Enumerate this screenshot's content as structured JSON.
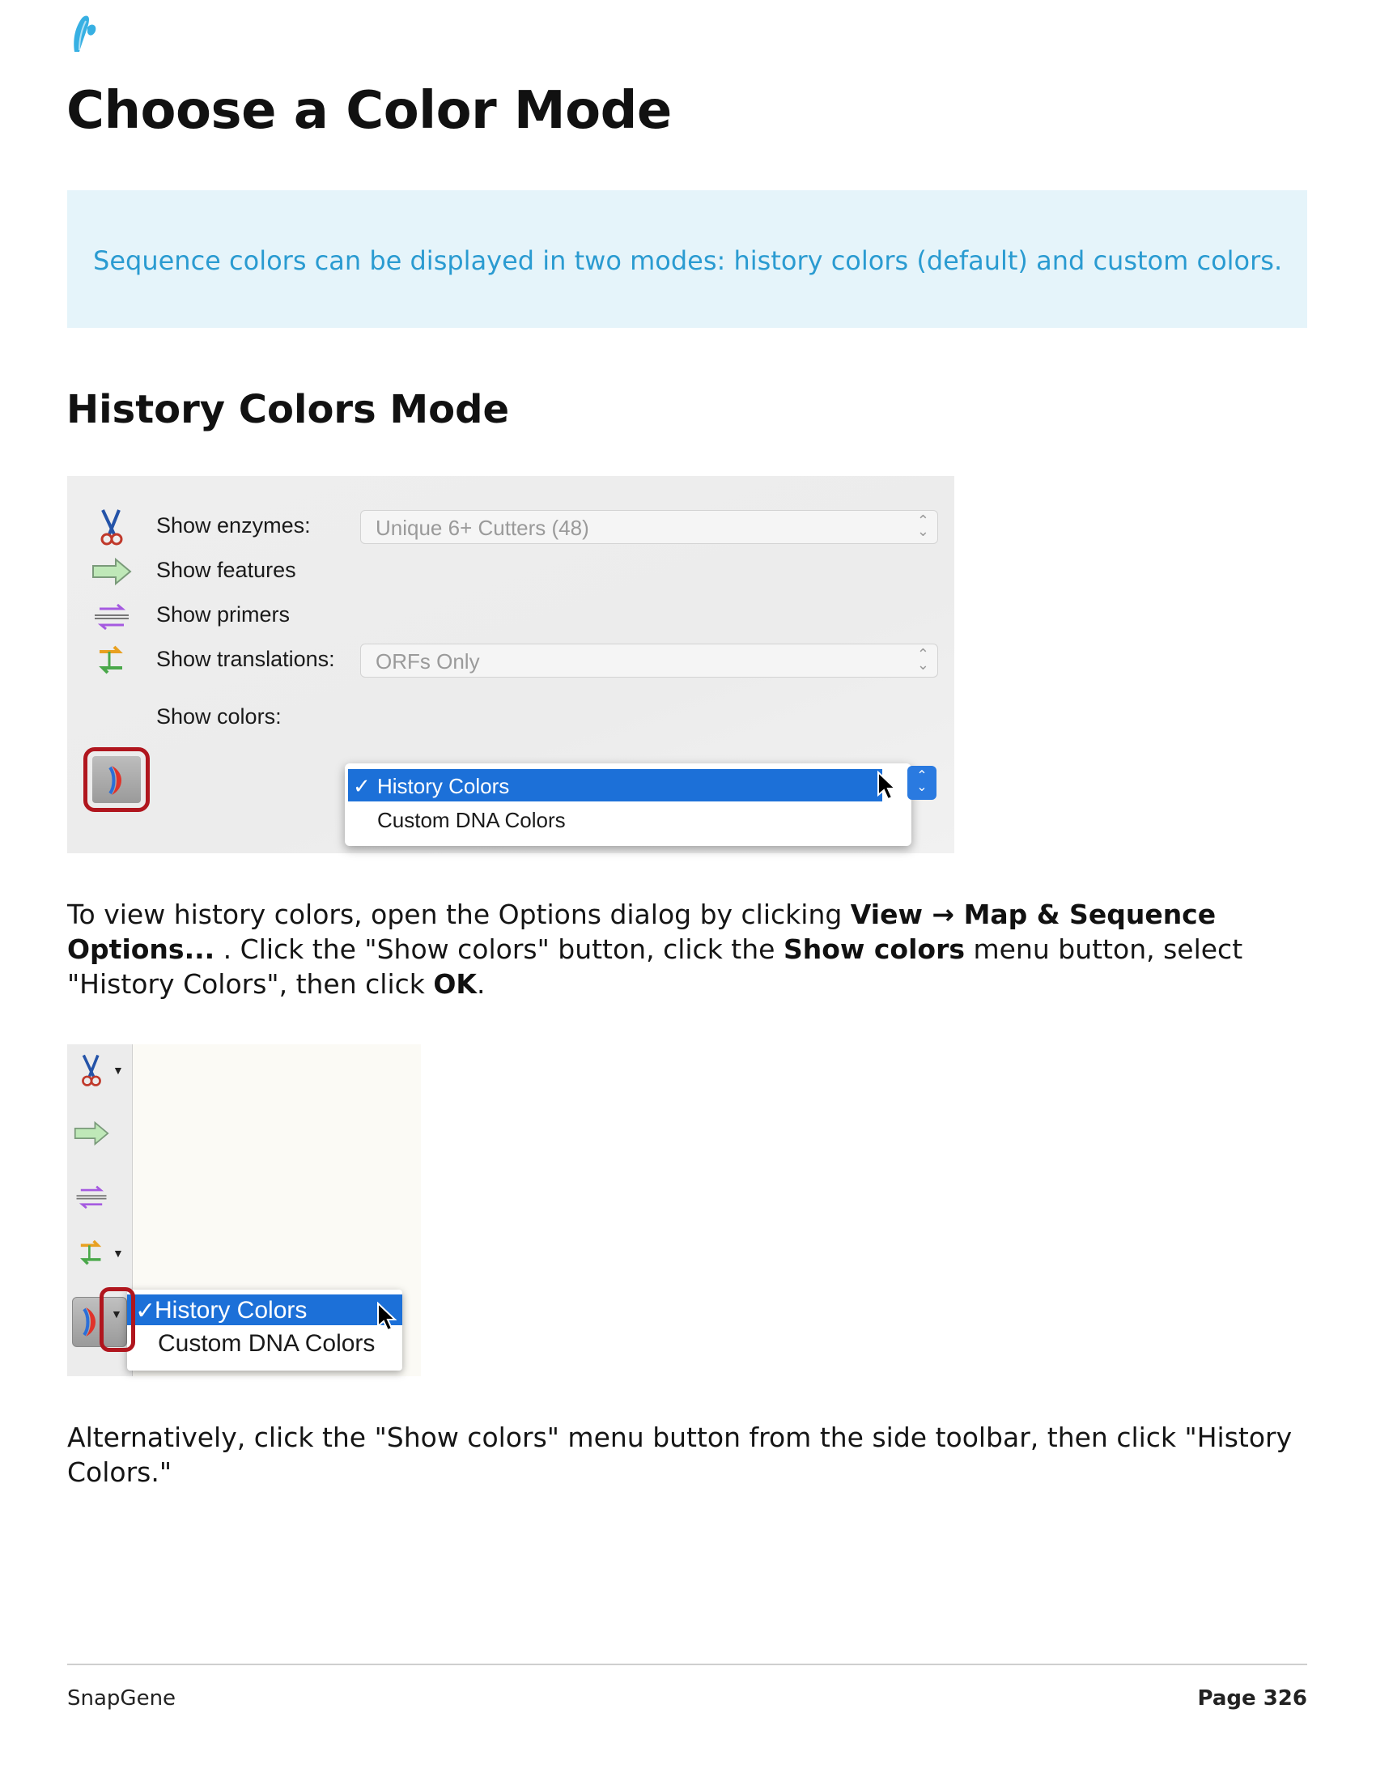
{
  "brand": {
    "accent": "#2a9bd1",
    "callout_bg": "#e5f4fa",
    "highlight": "#b0161e",
    "menu_selected": "#1c70d8"
  },
  "page_title": "Choose a Color Mode",
  "callout": {
    "text": "Sequence colors can be displayed in two modes: history colors (default) and custom colors."
  },
  "section_title": "History Colors Mode",
  "options_dialog": {
    "rows": [
      {
        "label": "Show enzymes:",
        "icon": "scissors-icon",
        "popup_value": "Unique 6+ Cutters  (48)"
      },
      {
        "label": "Show features",
        "icon": "feature-arrow-icon"
      },
      {
        "label": "Show primers",
        "icon": "primers-icon"
      },
      {
        "label": "Show translations:",
        "icon": "translations-icon",
        "popup_value": "ORFs Only"
      },
      {
        "label": "Show colors:",
        "icon": "colors-icon"
      }
    ],
    "menu": {
      "check": "✓",
      "selected": "History Colors",
      "other": "Custom DNA Colors"
    }
  },
  "para1": {
    "t1": "To view history colors, open the Options dialog by clicking ",
    "b1": "View → Map & Sequence Options...",
    "t2": " . Click the \"Show colors\" button, click the ",
    "b2": "Show colors",
    "t3": " menu button, select \"History Colors\", then click ",
    "b3": "OK",
    "t4": "."
  },
  "toolbar_shot": {
    "menu": {
      "check": "✓",
      "selected": "History Colors",
      "other": "Custom DNA Colors"
    },
    "caret": "▼"
  },
  "para2": {
    "text": "Alternatively, click the \"Show colors\" menu button from the side toolbar, then click \"History Colors.\""
  },
  "footer": {
    "left": "SnapGene",
    "right": "Page 326"
  }
}
